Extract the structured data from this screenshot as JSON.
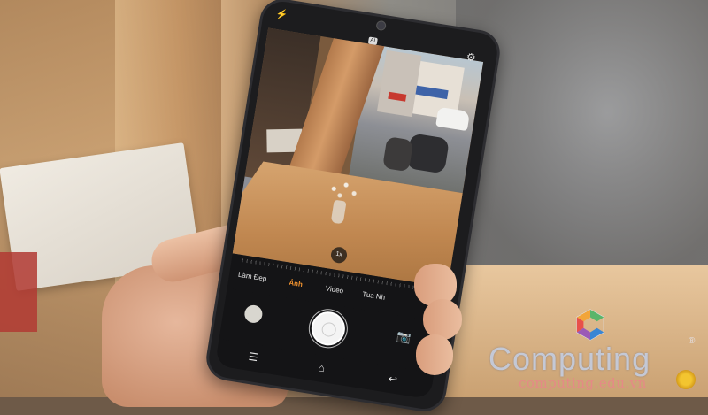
{
  "camera_app": {
    "zoom_label": "1x",
    "modes": [
      {
        "label": "Làm Đẹp",
        "selected": false
      },
      {
        "label": "Ảnh",
        "selected": true
      },
      {
        "label": "Video",
        "selected": false
      },
      {
        "label": "Tua Nh",
        "selected": false
      }
    ],
    "accent_color": "#f0922f",
    "icons": {
      "flash": "flash-icon",
      "hdr": "hdr-icon",
      "settings": "gear-icon",
      "gallery": "gallery-thumbnail",
      "shutter": "shutter-button",
      "switch_camera": "camera-switch-icon",
      "menu": "menu-icon",
      "home": "home-icon",
      "back": "back-icon"
    }
  },
  "watermark": {
    "brand": "Computing",
    "url": "computing.edu.vn",
    "registered": "®"
  }
}
